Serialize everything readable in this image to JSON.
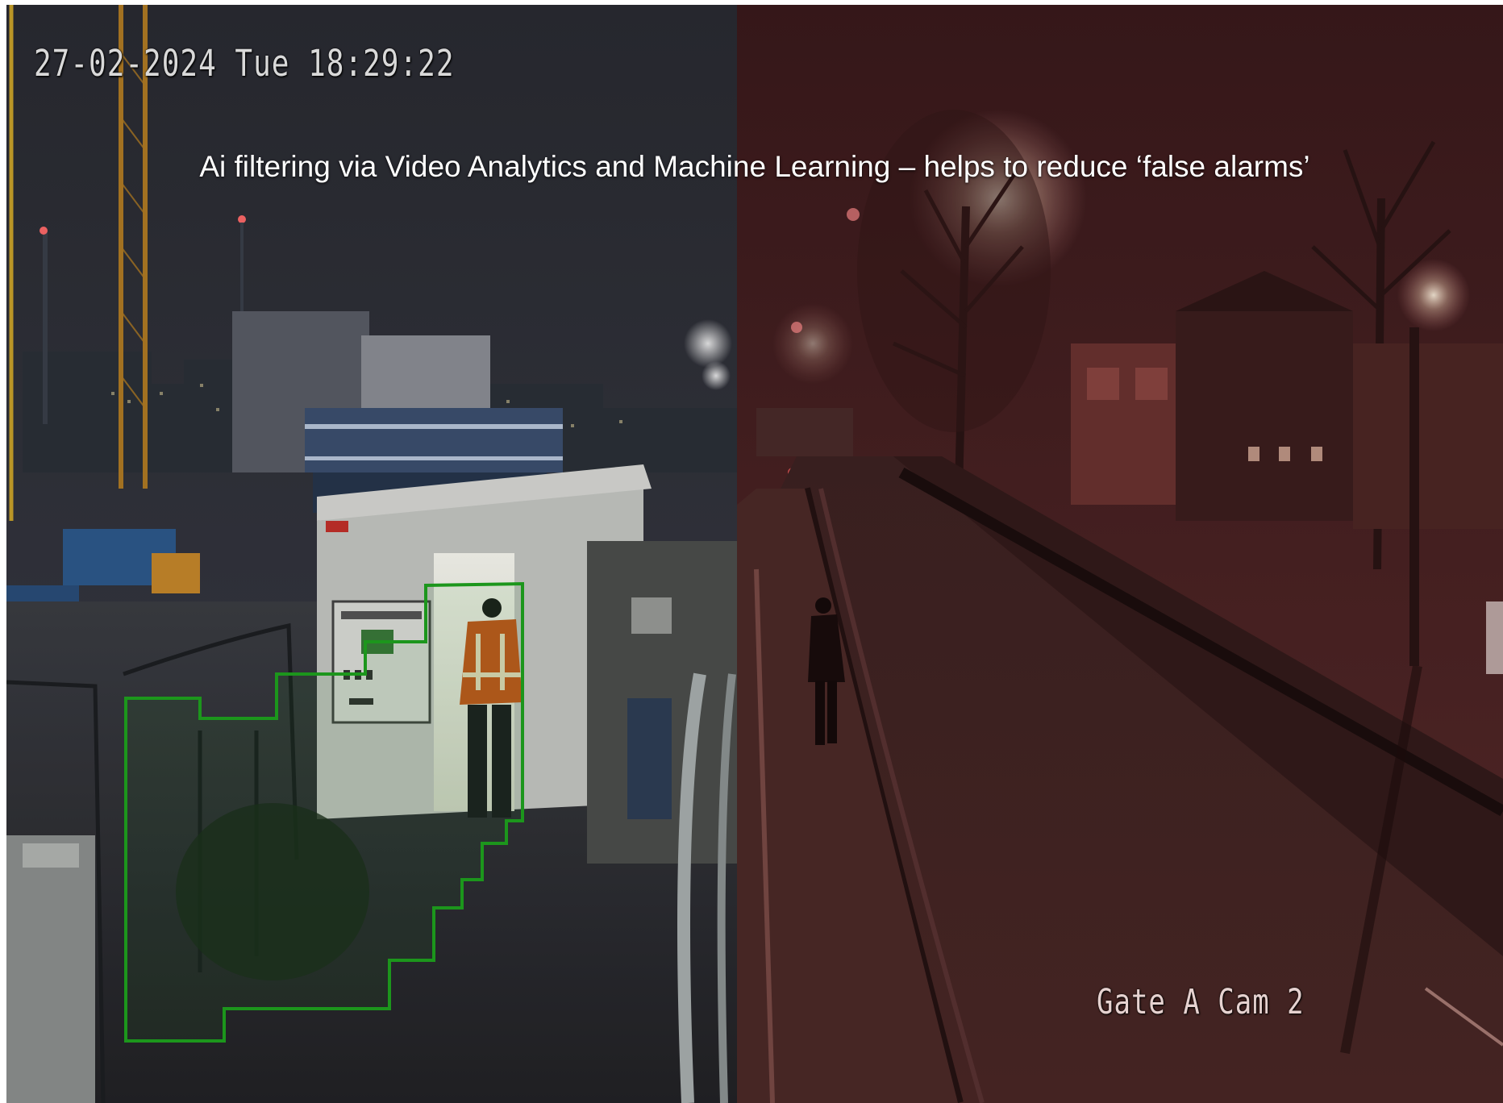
{
  "overlay": {
    "timestamp": "27-02-2024 Tue 18:29:22",
    "headline": "Ai filtering via Video Analytics and Machine Learning – helps to reduce ‘false alarms’",
    "camera_label": "Gate A Cam 2"
  },
  "scene": {
    "left_panel": "construction site at night with detection zone",
    "right_panel": "street at night, red tinted",
    "detection_zone_color": "#1fa31f",
    "right_tint_color": "#7a1f1c",
    "worker_vest_color": "#c85a1e"
  }
}
